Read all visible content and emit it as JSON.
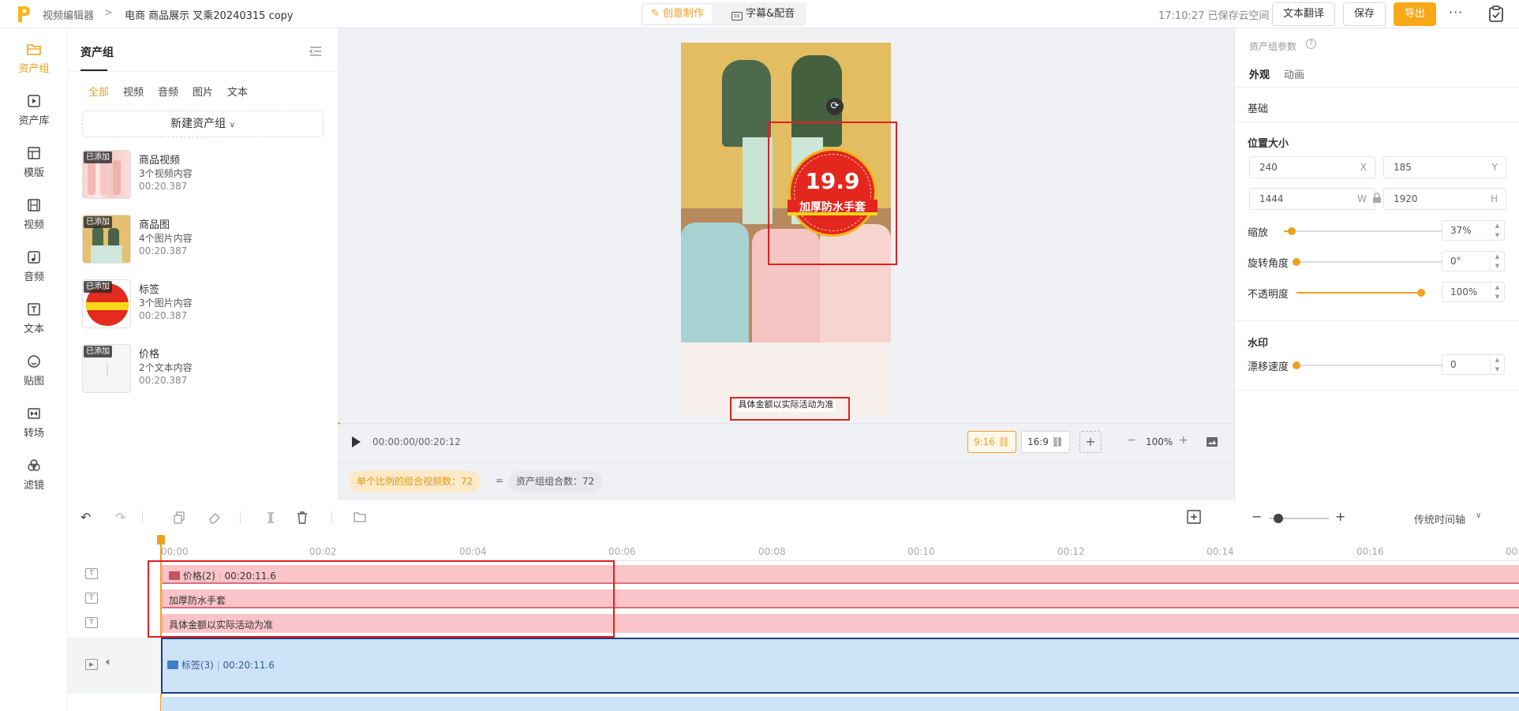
{
  "topbar": {
    "crumb_root": "视频编辑器",
    "crumb_sep": ">",
    "project_title": "电商  商品展示  叉乘20240315 copy",
    "mode_creative": "创意制作",
    "mode_subtitle": "字幕&配音",
    "save_status": "17:10:27 已保存云空间",
    "translate_label": "文本翻译",
    "save_label": "保存",
    "export_label": "导出",
    "more_label": "···"
  },
  "nav": {
    "items": [
      {
        "label": "资产组"
      },
      {
        "label": "资产库"
      },
      {
        "label": "模版"
      },
      {
        "label": "视频"
      },
      {
        "label": "音频"
      },
      {
        "label": "文本"
      },
      {
        "label": "贴图"
      },
      {
        "label": "转场"
      },
      {
        "label": "滤镜"
      }
    ]
  },
  "assets": {
    "panel_title": "资产组",
    "filters": [
      "全部",
      "视频",
      "音频",
      "图片",
      "文本"
    ],
    "new_group_label": "新建资产组",
    "cards": [
      {
        "badge": "已添加",
        "title": "商品视频",
        "sub": "3个视频内容",
        "duration": "00:20.387"
      },
      {
        "badge": "已添加",
        "title": "商品图",
        "sub": "4个图片内容",
        "duration": "00:20.387"
      },
      {
        "badge": "已添加",
        "title": "标签",
        "sub": "3个图片内容",
        "duration": "00:20.387"
      },
      {
        "badge": "已添加",
        "title": "价格",
        "sub": "2个文本内容",
        "duration": "00:20.387"
      }
    ]
  },
  "preview": {
    "price": "19.9",
    "tag_text": "加厚防水手套",
    "caption": "具体金额以实际活动为准",
    "time": "00:00:00/00:20:12",
    "ratio_916": "9:16",
    "ratio_169": "16:9",
    "zoom": "100%",
    "combo_label": "单个比例的组合视频数：72",
    "equals": "=",
    "group_count_label": "资产组组合数：72"
  },
  "props": {
    "header": "资产组参数",
    "tab_appearance": "外观",
    "tab_animation": "动画",
    "section_basic": "基础",
    "section_pos": "位置大小",
    "x_value": "240",
    "x_unit": "X",
    "y_value": "185",
    "y_unit": "Y",
    "w_value": "1444",
    "w_unit": "W",
    "h_value": "1920",
    "h_unit": "H",
    "scale_label": "缩放",
    "scale_value": "37%",
    "scale_level": 0.05,
    "rotate_label": "旋转角度",
    "rotate_value": "0°",
    "rotate_level": 0,
    "opacity_label": "不透明度",
    "opacity_value": "100%",
    "opacity_level": 1.0,
    "section_watermark": "水印",
    "drift_label": "漂移速度",
    "drift_value": "0",
    "drift_level": 0
  },
  "timeline": {
    "mode_label": "传统时间轴",
    "ticks": [
      "00:00",
      "00:02",
      "00:04",
      "00:06",
      "00:08",
      "00:10",
      "00:12",
      "00:14",
      "00:16",
      "00:1"
    ],
    "clips": [
      {
        "label": "价格(2)",
        "duration": "00:20:11.6"
      },
      {
        "label": "加厚防水手套"
      },
      {
        "label": "具体金额以实际活动为准"
      },
      {
        "label": "标签(3)",
        "duration": "00:20:11.6"
      }
    ]
  },
  "colors": {
    "accent": "#f9a818",
    "highlight_red": "#e02020",
    "text_clip": "#fbc4c9",
    "media_clip": "#cfe3f8"
  }
}
